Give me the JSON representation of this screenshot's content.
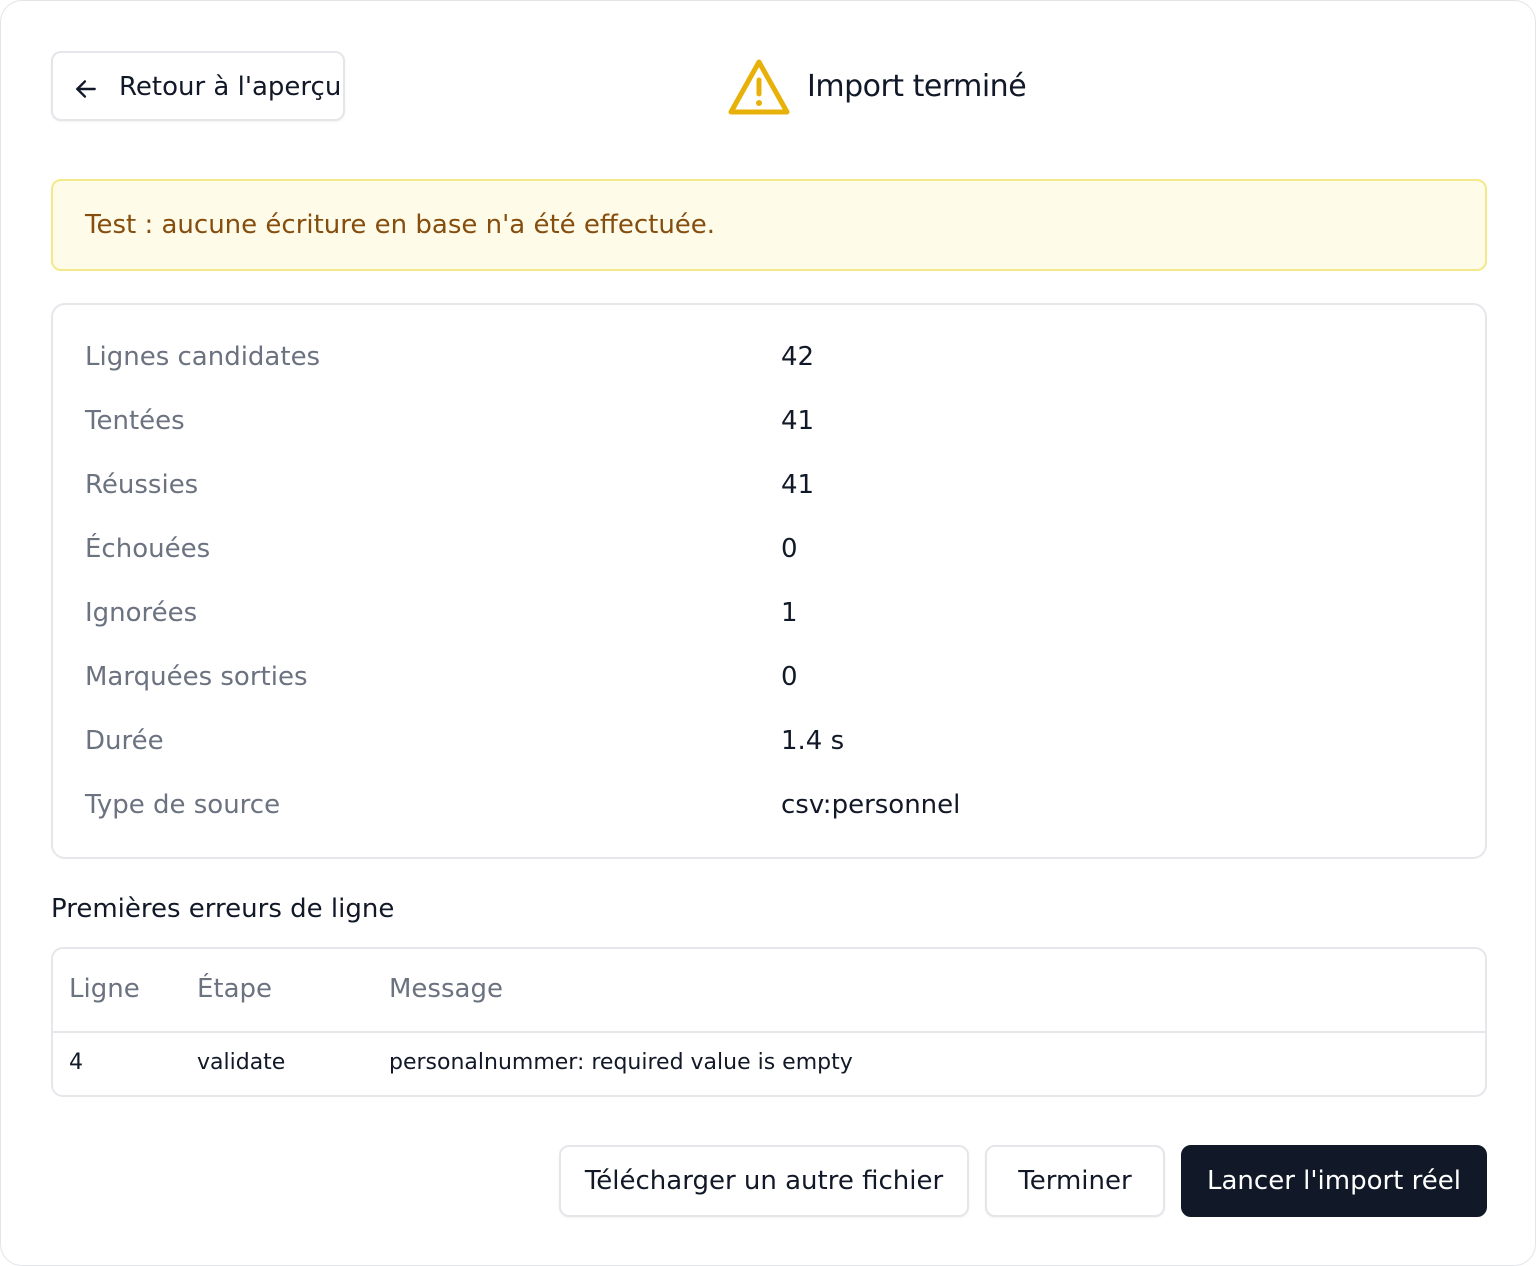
{
  "header": {
    "back_label": "Retour à l'aperçu",
    "title": "Import terminé",
    "warning_color": "#e8b10a"
  },
  "alert": {
    "text": "Test : aucune écriture en base n'a été effectuée."
  },
  "stats": [
    {
      "label": "Lignes candidates",
      "value": "42"
    },
    {
      "label": "Tentées",
      "value": "41"
    },
    {
      "label": "Réussies",
      "value": "41"
    },
    {
      "label": "Échouées",
      "value": "0"
    },
    {
      "label": "Ignorées",
      "value": "1"
    },
    {
      "label": "Marquées sorties",
      "value": "0"
    },
    {
      "label": "Durée",
      "value": "1.4 s"
    },
    {
      "label": "Type de source",
      "value": "csv:personnel"
    }
  ],
  "errors": {
    "title": "Premières erreurs de ligne",
    "columns": [
      "Ligne",
      "Étape",
      "Message"
    ],
    "rows": [
      {
        "line": "4",
        "step": "validate",
        "message": "personalnummer: required value is empty"
      }
    ]
  },
  "actions": {
    "upload_another": "Télécharger un autre fichier",
    "finish": "Terminer",
    "run_real_import": "Lancer l'import réel"
  }
}
